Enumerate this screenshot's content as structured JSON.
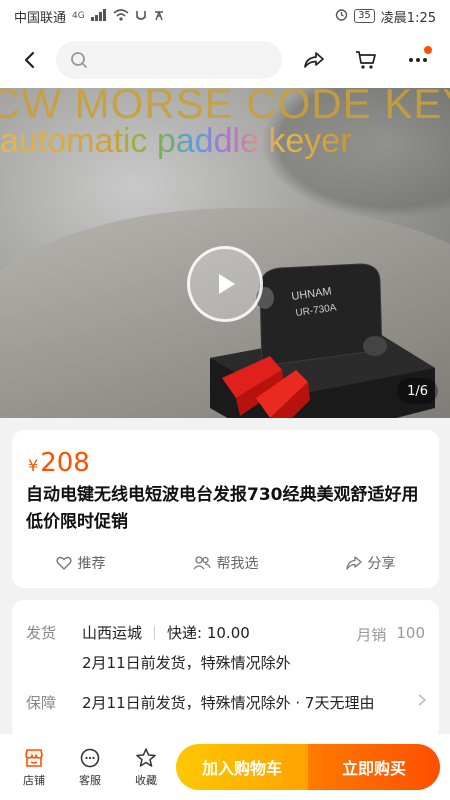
{
  "status_bar": {
    "carrier": "中国联通",
    "network": "4G",
    "battery": "35",
    "time": "凌晨1:25",
    "icons": [
      "signal-icon",
      "wifi-icon",
      "alarm-icon"
    ]
  },
  "top_nav": {
    "search_placeholder": "",
    "icons": [
      "back-icon",
      "search-icon",
      "share-icon",
      "cart-icon",
      "more-icon"
    ]
  },
  "hero": {
    "overlay_line1": "CW MORSE CODE KEYS",
    "overlay_line2": "automatic paddle keyer",
    "device_label": "UHNAM",
    "device_model": "UR-730A",
    "image_counter": "1/6"
  },
  "product": {
    "currency": "¥",
    "price": "208",
    "title": "自动电键无线电短波电台发报730经典美观舒适好用低价限时促销",
    "actions": [
      {
        "label": "推荐",
        "icon": "heart-icon"
      },
      {
        "label": "帮我选",
        "icon": "people-icon"
      },
      {
        "label": "分享",
        "icon": "share-icon"
      }
    ]
  },
  "shipping": {
    "ship_label": "发货",
    "origin": "山西运城",
    "express": "快递: 10.00",
    "monthly_label": "月销",
    "monthly_value": "100",
    "ship_note": "2月11日前发货，特殊情况除外",
    "guarantee_label": "保障",
    "guarantee_text": "2月11日前发货，特殊情况除外 · 7天无理由"
  },
  "bottom_bar": {
    "tabs": [
      {
        "label": "店铺",
        "icon": "store-icon"
      },
      {
        "label": "客服",
        "icon": "chat-icon"
      },
      {
        "label": "收藏",
        "icon": "star-icon"
      }
    ],
    "add_to_cart": "加入购物车",
    "buy_now": "立即购买"
  },
  "colors": {
    "accent": "#ff5000",
    "cart_button": "#ffb400",
    "buy_button": "#ff5a00"
  }
}
